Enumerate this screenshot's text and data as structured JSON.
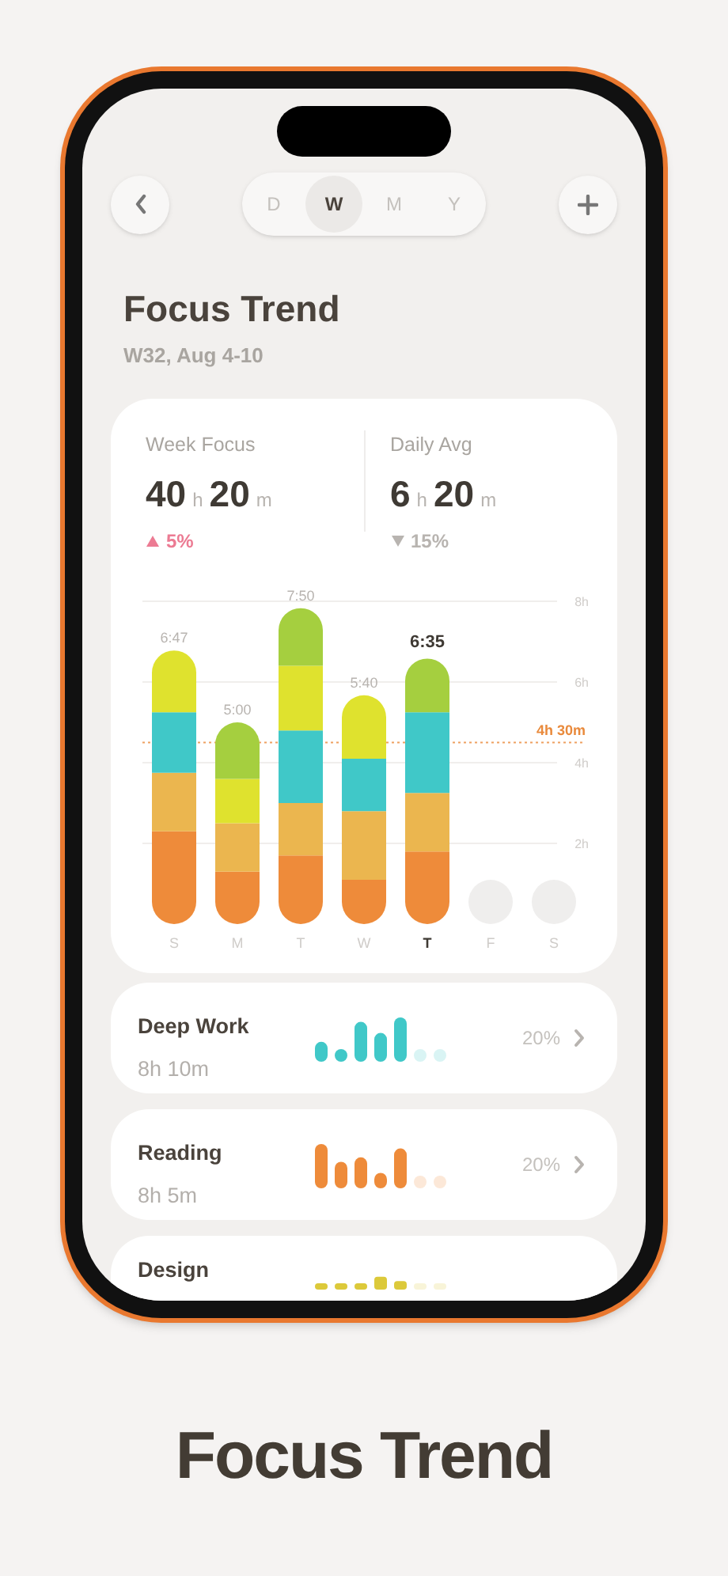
{
  "period_tabs": [
    {
      "label": "D",
      "selected": false
    },
    {
      "label": "W",
      "selected": true
    },
    {
      "label": "M",
      "selected": false
    },
    {
      "label": "Y",
      "selected": false
    }
  ],
  "title": "Focus Trend",
  "subtitle": "W32, Aug 4-10",
  "summary": [
    {
      "label": "Week Focus",
      "hours": "40",
      "hours_unit": "h",
      "minutes": "20",
      "minutes_unit": "m",
      "change": "5%",
      "increase": true
    },
    {
      "label": "Daily Avg",
      "hours": "6",
      "hours_unit": "h",
      "minutes": "20",
      "minutes_unit": "m",
      "change": "15%",
      "increase": false
    }
  ],
  "chart": {
    "highlighted_days": [
      false,
      false,
      false,
      false,
      true,
      false,
      false
    ],
    "chart_data": {
      "type": "bar",
      "stacked": true,
      "categories": [
        "S",
        "M",
        "T",
        "W",
        "T",
        "F",
        "S"
      ],
      "series": [
        {
          "color": "#ee8b3a",
          "values": [
            2.3,
            1.3,
            1.7,
            1.1,
            1.8,
            null,
            null
          ]
        },
        {
          "color": "#ebb64f",
          "values": [
            1.45,
            1.2,
            1.3,
            1.7,
            1.45,
            null,
            null
          ]
        },
        {
          "color": "#40c8c8",
          "values": [
            1.5,
            0,
            1.8,
            1.3,
            2.0,
            null,
            null
          ]
        },
        {
          "color": "#dfe22e",
          "values": [
            1.53,
            1.1,
            1.6,
            1.57,
            0,
            null,
            null
          ]
        },
        {
          "color": "#a5cf3f",
          "values": [
            0,
            1.4,
            1.43,
            0,
            1.33,
            null,
            null
          ]
        }
      ],
      "grid": true,
      "ylim": [
        0,
        8
      ],
      "yticks": [
        {
          "value": 2,
          "label": "2h"
        },
        {
          "value": 4,
          "label": "4h"
        },
        {
          "value": 6,
          "label": "6h"
        },
        {
          "value": 8,
          "label": "8h"
        }
      ],
      "value_labels": [
        "6:47",
        "5:00",
        "7:50",
        "5:40",
        "6:35",
        null,
        null
      ],
      "ref_lines": [
        {
          "axis": "y",
          "value": 4.5,
          "label": "4h 30m"
        }
      ]
    }
  },
  "categories": [
    {
      "name": "Deep Work",
      "time": "8h 10m",
      "share": "20%",
      "color": "#40c8c8"
    },
    {
      "name": "Reading",
      "time": "8h 5m",
      "share": "20%",
      "color": "#ee8b3a"
    },
    {
      "name": "Design",
      "color": "#dcc93a"
    }
  ],
  "caption": "Focus Trend"
}
